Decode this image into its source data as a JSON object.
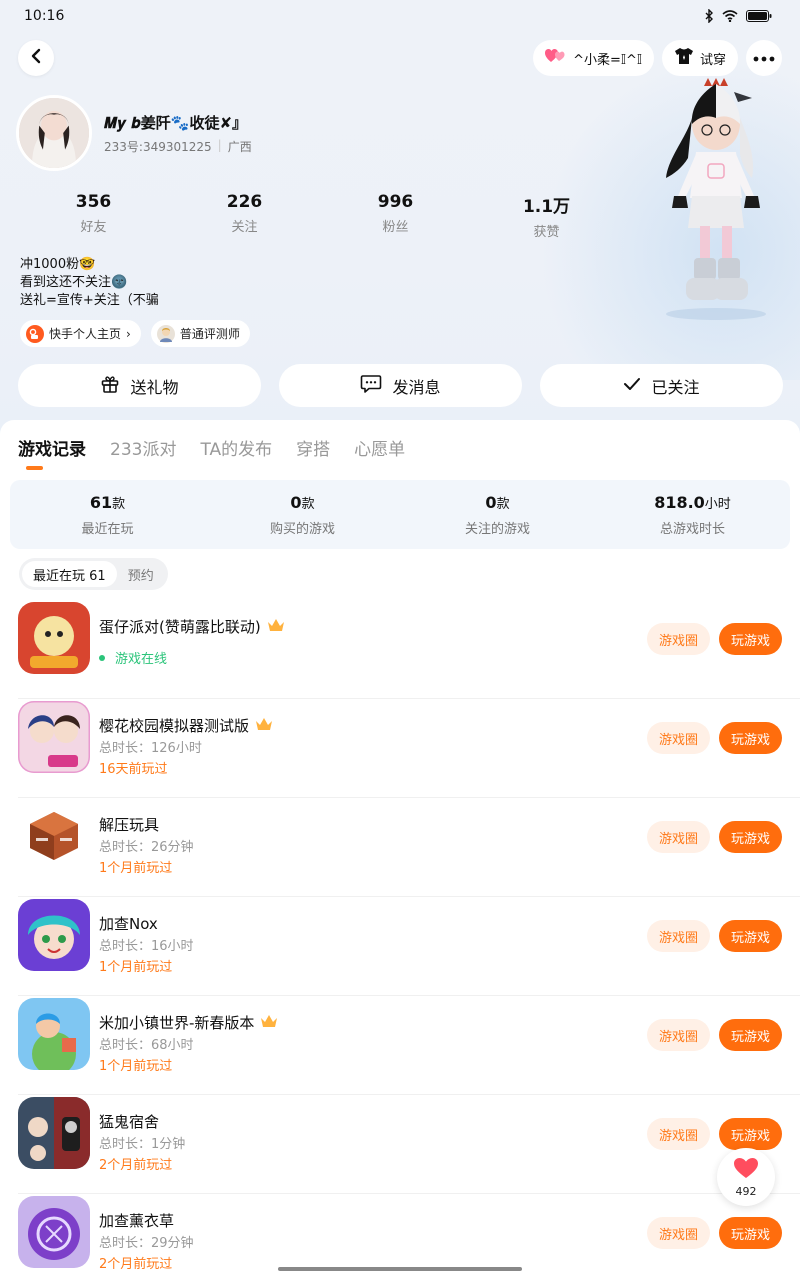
{
  "status_bar": {
    "time": "10:16",
    "icons": [
      "bluetooth-icon",
      "wifi-icon",
      "battery-icon"
    ]
  },
  "nav": {
    "back_icon": "chevron-left-icon",
    "relation_label": "^小柔=𝕀^𝕀",
    "try_on_label": "试穿",
    "more_icon": "more-dots-icon"
  },
  "profile": {
    "nickname": "𝑴𝒚 𝒃姜阡🐾收徒✘』",
    "uid": "233号:349301225",
    "location": "广西",
    "stats": [
      {
        "value": "356",
        "label": "好友"
      },
      {
        "value": "226",
        "label": "关注"
      },
      {
        "value": "996",
        "label": "粉丝"
      },
      {
        "value": "1.1万",
        "label": "获赞"
      }
    ],
    "bio_lines": [
      "冲1000粉🤓",
      "看到这还不关注🌚",
      "送礼=宣传+关注（不骗"
    ],
    "tags": [
      {
        "label": "快手个人主页",
        "icon": "kuaishou-icon",
        "arrow": "›"
      },
      {
        "label": "普通评测师",
        "icon": "reviewer-badge-icon"
      }
    ]
  },
  "actions": {
    "gift": "送礼物",
    "message": "发消息",
    "followed": "已关注"
  },
  "tabs": [
    "游戏记录",
    "233派对",
    "TA的发布",
    "穿搭",
    "心愿单"
  ],
  "summary": [
    {
      "value": "61",
      "unit": "款",
      "label": "最近在玩"
    },
    {
      "value": "0",
      "unit": "款",
      "label": "购买的游戏"
    },
    {
      "value": "0",
      "unit": "款",
      "label": "关注的游戏"
    },
    {
      "value": "818.0",
      "unit": "小时",
      "label": "总游戏时长"
    }
  ],
  "segment": {
    "recent": "最近在玩 61",
    "reserve": "预约"
  },
  "buttons": {
    "circle": "游戏圈",
    "play": "玩游戏"
  },
  "games": [
    {
      "name": "蛋仔派对(赞萌露比联动)",
      "online": "游戏在线",
      "crown": true
    },
    {
      "name": "樱花校园模拟器测试版",
      "duration": "总时长：126小时",
      "last": "16天前玩过",
      "crown": true
    },
    {
      "name": "解压玩具",
      "duration": "总时长：26分钟",
      "last": "1个月前玩过"
    },
    {
      "name": "加查Nox",
      "duration": "总时长：16小时",
      "last": "1个月前玩过"
    },
    {
      "name": "米加小镇世界-新春版本",
      "duration": "总时长：68小时",
      "last": "1个月前玩过",
      "crown": true
    },
    {
      "name": "猛鬼宿舍",
      "duration": "总时长：1分钟",
      "last": "2个月前玩过"
    },
    {
      "name": "加查薰衣草",
      "duration": "总时长：29分钟",
      "last": "2个月前玩过"
    }
  ],
  "favorite": {
    "count": "492",
    "icon": "heart-icon"
  },
  "colors": {
    "accent": "#ff6d0d",
    "accent_light": "#fff0e6",
    "online": "#2bc47a"
  }
}
